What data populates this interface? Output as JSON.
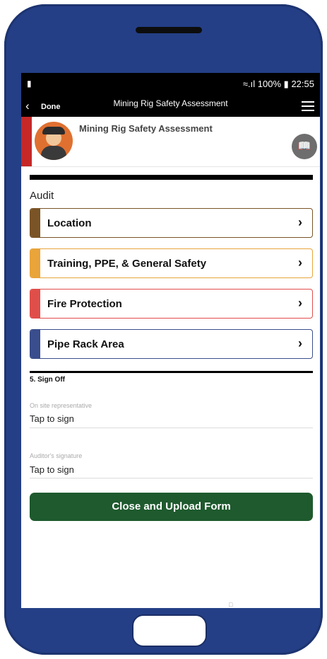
{
  "status": {
    "left_icon": "battery-saver-icon",
    "signal": "wifi-signal-icon",
    "battery_text": "100%",
    "time": "22:55"
  },
  "nav": {
    "done_label": "Done",
    "title": "Mining Rig Safety Assessment"
  },
  "form": {
    "title": "Mining Rig Safety Assessment",
    "book_icon": "book-icon"
  },
  "audit_label": "Audit",
  "sections": [
    {
      "label": "Location",
      "color": "#7a5426"
    },
    {
      "label": "Training, PPE, & General Safety",
      "color": "#e9a43a"
    },
    {
      "label": "Fire Protection",
      "color": "#e04e4a"
    },
    {
      "label": "Pipe Rack Area",
      "color": "#3a4d8c"
    }
  ],
  "signoff": {
    "title": "5. Sign Off",
    "representative_label": "On site representative",
    "representative_value": "Tap to sign",
    "auditor_label": "Auditor's signature",
    "auditor_value": "Tap to sign"
  },
  "upload_button": "Close and Upload Form"
}
